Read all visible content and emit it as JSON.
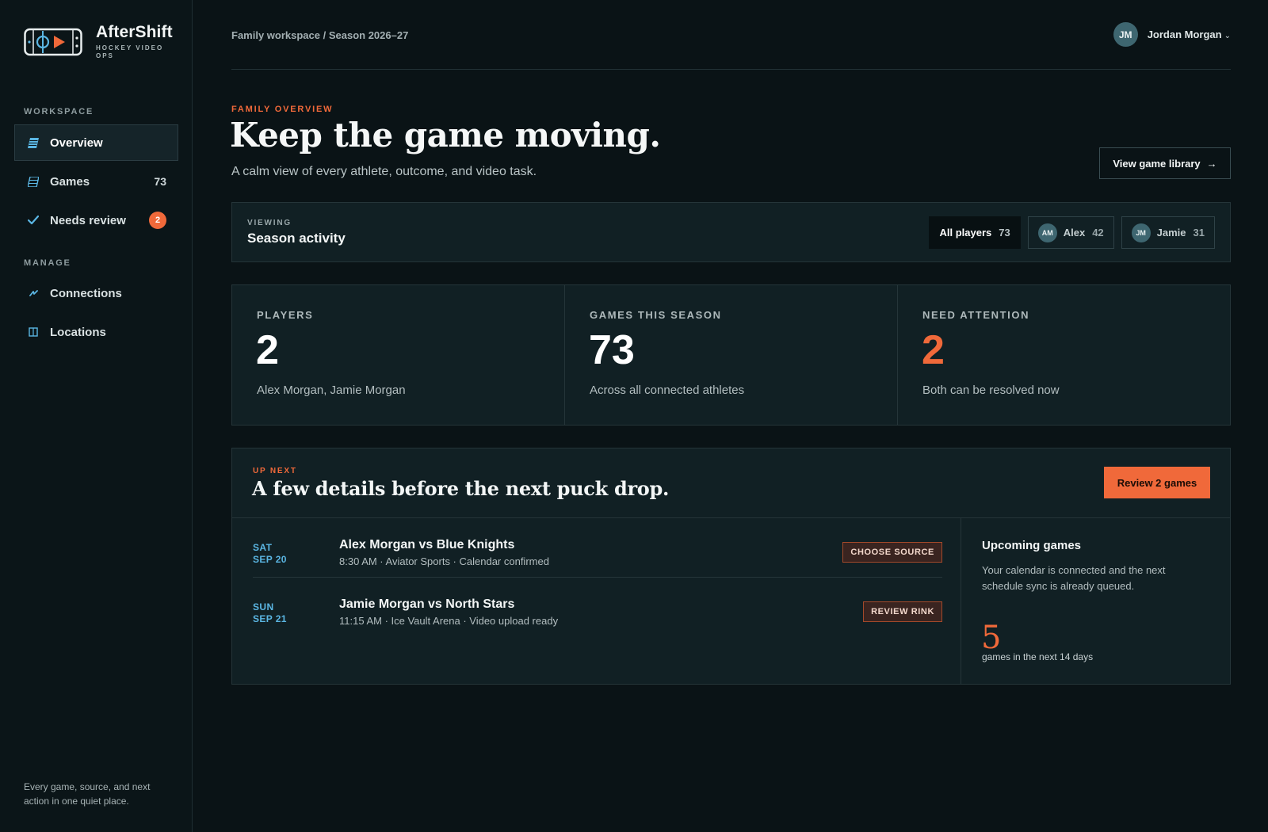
{
  "app": {
    "name": "AfterShift",
    "subtitle": "HOCKEY VIDEO OPS",
    "accent": "#f0693a",
    "link_color": "#5bb6e3"
  },
  "sidebar": {
    "sections": {
      "workspace": "WORKSPACE",
      "manage": "MANAGE"
    },
    "items": [
      {
        "label": "Overview",
        "icon": "overview-icon",
        "active": true
      },
      {
        "label": "Games",
        "icon": "games-icon",
        "count": "73"
      },
      {
        "label": "Needs review",
        "icon": "check-icon",
        "badge": "2"
      },
      {
        "label": "Connections",
        "icon": "connections-icon"
      },
      {
        "label": "Locations",
        "icon": "locations-icon"
      }
    ],
    "footer": "Every game, source, and next action in one quiet place."
  },
  "topbar": {
    "breadcrumb": "Family workspace / Season 2026–27",
    "user": {
      "initials": "JM",
      "name": "Jordan Morgan"
    }
  },
  "hero": {
    "eyebrow": "FAMILY OVERVIEW",
    "title": "Keep the game moving.",
    "subtitle": "A calm view of every athlete, outcome, and video task.",
    "library_button": "View game library",
    "library_arrow": "→"
  },
  "filter": {
    "eyebrow": "VIEWING",
    "title": "Season activity",
    "chips": [
      {
        "label": "All players",
        "count": "73",
        "active": true
      },
      {
        "initials": "AM",
        "label": "Alex",
        "count": "42"
      },
      {
        "initials": "JM",
        "label": "Jamie",
        "count": "31"
      }
    ]
  },
  "stats": [
    {
      "label": "PLAYERS",
      "value": "2",
      "desc": "Alex Morgan, Jamie Morgan"
    },
    {
      "label": "GAMES THIS SEASON",
      "value": "73",
      "desc": "Across all connected athletes"
    },
    {
      "label": "NEED ATTENTION",
      "value": "2",
      "desc": "Both can be resolved now"
    }
  ],
  "upnext": {
    "eyebrow": "UP NEXT",
    "title": "A few details before the next puck drop.",
    "review_button": "Review 2 games",
    "games": [
      {
        "dow": "SAT",
        "date": "SEP 20",
        "title": "Alex Morgan vs Blue Knights",
        "meta": "8:30 AM · Aviator Sports · Calendar confirmed",
        "tag": "CHOOSE SOURCE"
      },
      {
        "dow": "SUN",
        "date": "SEP 21",
        "title": "Jamie Morgan vs North Stars",
        "meta": "11:15 AM · Ice Vault Arena · Video upload ready",
        "tag": "REVIEW RINK"
      }
    ],
    "upcoming": {
      "title": "Upcoming games",
      "desc": "Your calendar is connected and the next schedule sync is already queued.",
      "count": "5",
      "caption": "games in the next 14 days"
    }
  }
}
